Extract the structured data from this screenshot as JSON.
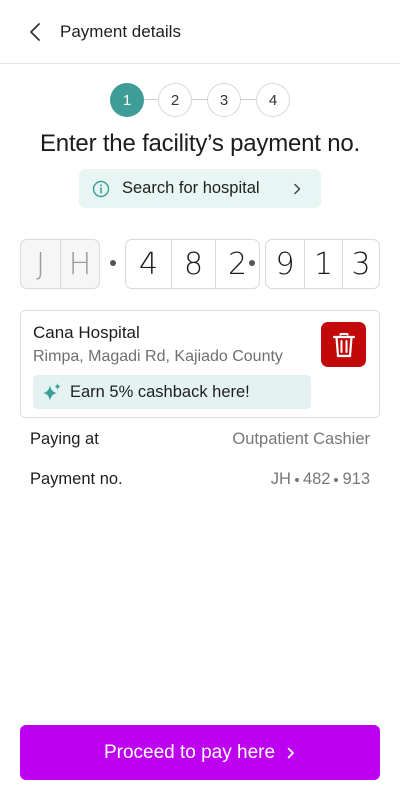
{
  "header": {
    "title": "Payment details",
    "back_icon": "chevron-left-icon"
  },
  "stepper": {
    "steps": [
      "1",
      "2",
      "3",
      "4"
    ],
    "active_step": 1,
    "active_color": "#3f9d97"
  },
  "main": {
    "title": "Enter the facility’s payment no.",
    "search": {
      "label": "Search for hospital",
      "icon": "info-icon",
      "chevron": "chevron-right-icon"
    }
  },
  "payment_code": {
    "prefix": [
      "J",
      "H"
    ],
    "part1": [
      "4",
      "8",
      "2"
    ],
    "part2": [
      "9",
      "1",
      "3"
    ]
  },
  "hospital": {
    "name": "Cana Hospital",
    "address": "Rimpa, Magadi Rd, Kajiado County",
    "delete_icon": "trash-icon",
    "delete_color": "#c10909",
    "cashback": "Earn 5% cashback here!",
    "cashback_icon": "sparkle-icon"
  },
  "details": {
    "paying_at_label": "Paying at",
    "paying_at_value": "Outpatient Cashier",
    "payment_no_label": "Payment no.",
    "payment_no_parts": [
      "JH",
      "482",
      "913"
    ]
  },
  "footer": {
    "proceed_label": "Proceed to pay here",
    "proceed_color": "#bd00f0"
  }
}
